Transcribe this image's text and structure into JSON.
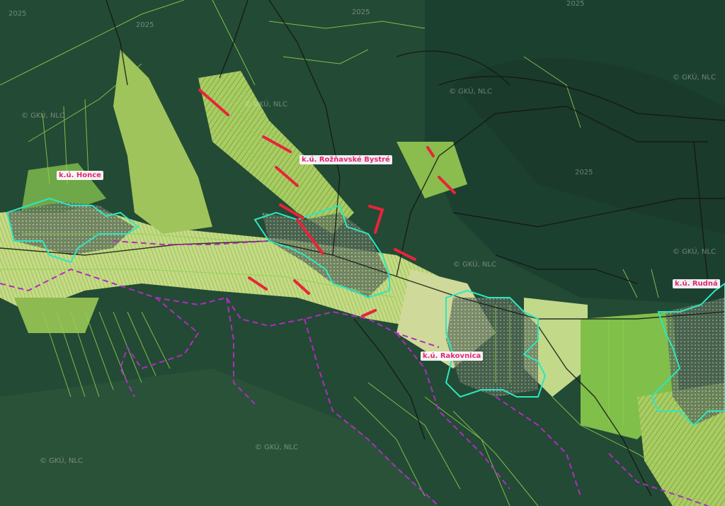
{
  "map": {
    "colors": {
      "forest": "#234a34",
      "forest_dark": "#163325",
      "field": "#9ec45a",
      "field_light": "#c9dc8a",
      "parcel_line": "#8fd14f",
      "cadastre_boundary": "#b02cc0",
      "settlement_outline": "#2ee6c2",
      "highlight": "#e8243a",
      "road": "#1b1b1b",
      "label_text": "#e8247a"
    },
    "labels": {
      "honce": "k.ú. Honce",
      "roznavske_bystre": "k.ú. Rožňavské Bystré",
      "rakovnica": "k.ú. Rakovnica",
      "rudna": "k.ú. Rudná"
    },
    "watermarks": {
      "gku_1": "© GKÚ, NLC",
      "gku_2": "© GKÚ, NLC",
      "gku_3": "© GKÚ, NLC",
      "gku_4": "© GKÚ, NLC",
      "gku_5": "© GKÚ, NLC",
      "gku_6": "© GKÚ, NLC",
      "gku_7": "© GKÚ, NLC",
      "gku_8": "© GKÚ, NLC",
      "year_1": "2025",
      "year_2": "2025",
      "year_3": "2025",
      "year_4": "2025",
      "year_5": "2025"
    }
  }
}
